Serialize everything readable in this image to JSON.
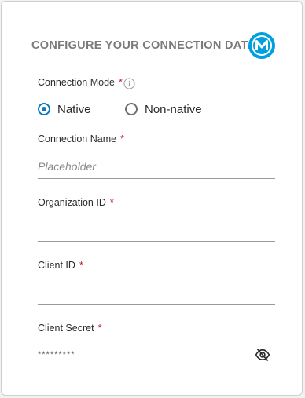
{
  "header": {
    "title": "CONFIGURE YOUR CONNECTION DATA",
    "logo_letter": "M",
    "logo_color": "#00a0df"
  },
  "connection_mode": {
    "label": "Connection Mode",
    "required_mark": "*",
    "options": [
      {
        "label": "Native",
        "selected": true
      },
      {
        "label": "Non-native",
        "selected": false
      }
    ]
  },
  "connection_name": {
    "label": "Connection Name",
    "required_mark": "*",
    "placeholder": "Placeholder",
    "value": ""
  },
  "organization_id": {
    "label": "Organization ID",
    "required_mark": "*",
    "value": ""
  },
  "client_id": {
    "label": "Client ID",
    "required_mark": "*",
    "value": ""
  },
  "client_secret": {
    "label": "Client Secret",
    "required_mark": "*",
    "value": "*********",
    "visibility_icon": "eye-off-icon"
  },
  "colors": {
    "accent": "#0b7ac0",
    "required": "#c0182b"
  }
}
